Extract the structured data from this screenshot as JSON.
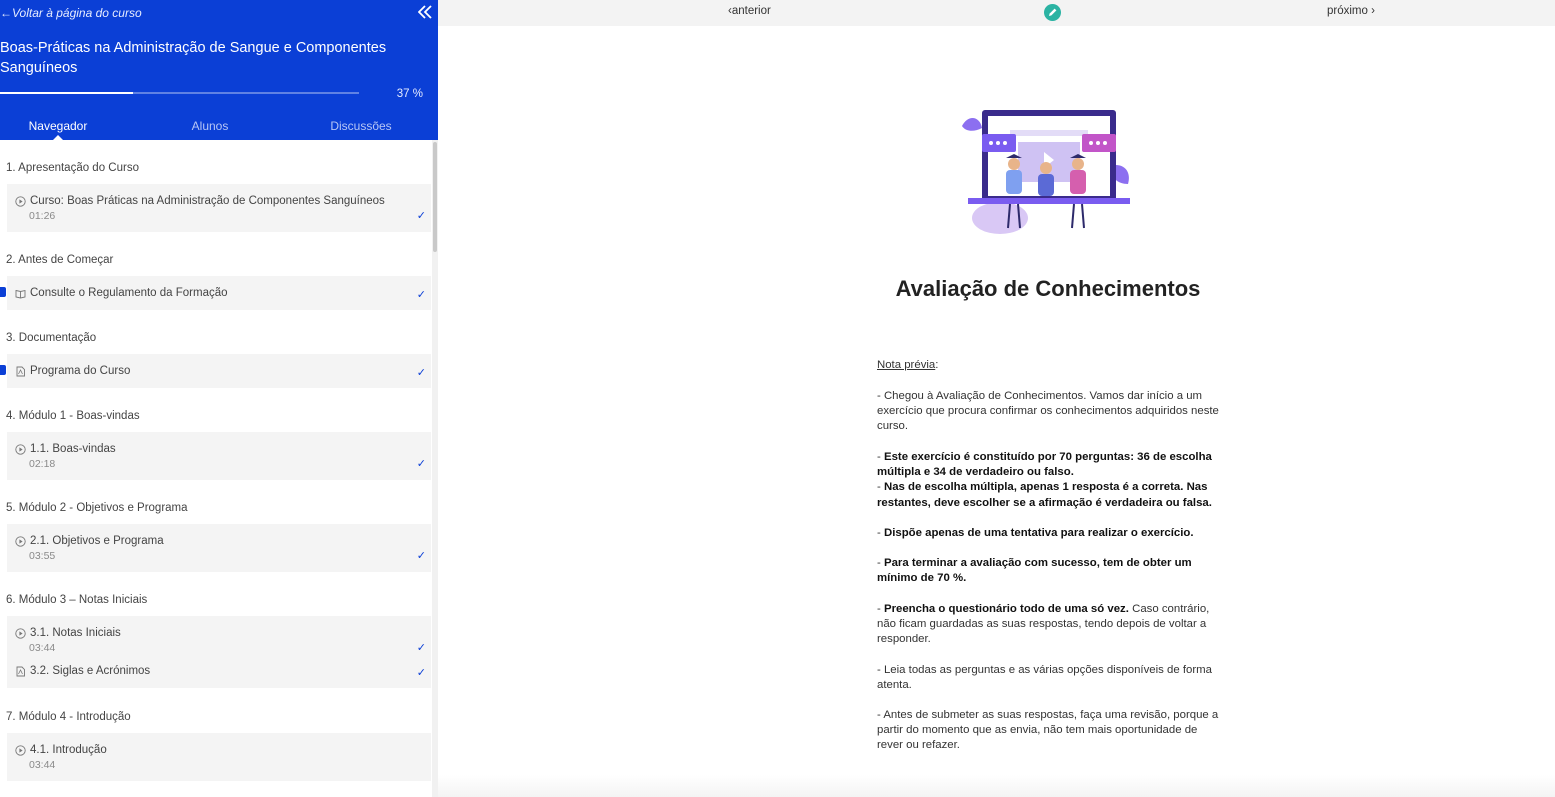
{
  "sidebar": {
    "back_link": "←Voltar à página do curso",
    "course_title": "Boas-Práticas na Administração de Sangue e Componentes Sanguíneos",
    "progress_percent": 37,
    "progress_label": "37 %",
    "tabs": [
      {
        "label": "Navegador",
        "active": true
      },
      {
        "label": "Alunos",
        "active": false
      },
      {
        "label": "Discussões",
        "active": false
      }
    ],
    "sections": [
      {
        "title": "1. Apresentação do Curso",
        "lessons": [
          {
            "icon": "play-circle-icon",
            "label": "Curso: Boas Práticas na Administração de Componentes Sanguíneos",
            "duration": "01:26",
            "completed": true
          }
        ]
      },
      {
        "title": "2. Antes de Começar",
        "lessons": [
          {
            "icon": "book-icon",
            "label": "Consulte o Regulamento da Formação",
            "duration": "",
            "completed": true
          }
        ]
      },
      {
        "title": "3. Documentação",
        "lessons": [
          {
            "icon": "pdf-icon",
            "label": "Programa do Curso",
            "duration": "",
            "completed": true
          }
        ]
      },
      {
        "title": "4. Módulo 1 - Boas-vindas",
        "lessons": [
          {
            "icon": "play-circle-icon",
            "label": "1.1. Boas-vindas",
            "duration": "02:18",
            "completed": true
          }
        ]
      },
      {
        "title": "5. Módulo 2 - Objetivos e Programa",
        "lessons": [
          {
            "icon": "play-circle-icon",
            "label": "2.1. Objetivos e Programa",
            "duration": "03:55",
            "completed": true
          }
        ]
      },
      {
        "title": "6. Módulo 3 – Notas Iniciais",
        "lessons": [
          {
            "icon": "play-circle-icon",
            "label": "3.1. Notas Iniciais",
            "duration": "03:44",
            "completed": true
          },
          {
            "icon": "pdf-icon",
            "label": "3.2. Siglas e Acrónimos",
            "duration": "",
            "completed": true
          }
        ]
      },
      {
        "title": "7. Módulo 4 - Introdução",
        "lessons": [
          {
            "icon": "play-circle-icon",
            "label": "4.1. Introdução",
            "duration": "03:44",
            "completed": false
          }
        ]
      }
    ],
    "check_glyph": "✓"
  },
  "topbar": {
    "prev_label": "anterior",
    "next_label": "próximo",
    "accent_color": "#2bb3a3"
  },
  "content": {
    "heading": "Avaliação de Conhecimentos",
    "note_label": "Nota prévia",
    "p1": "- Chegou à Avaliação de Conhecimentos. Vamos dar início a um exercício que procura confirmar os conhecimentos adquiridos neste curso.",
    "p2_bold": "Este exercício é constituído por 70 perguntas: 36 de escolha múltipla e 34 de verdadeiro ou falso.",
    "p3_bold": "Nas de escolha múltipla, apenas 1 resposta é a correta. Nas restantes, deve escolher se a afirmação é verdadeira ou falsa.",
    "p4_bold": "Dispõe apenas de uma tentativa para realizar o exercício.",
    "p5_bold": "Para terminar a avaliação com sucesso, tem de obter um mínimo de 70 %.",
    "p6_bold": "Preencha o questionário todo de uma só vez.",
    "p6_rest": " Caso contrário, não ficam guardadas as suas respostas, tendo depois de voltar a responder.",
    "p7": "- Leia todas as perguntas e as várias opções disponíveis de forma atenta.",
    "p8": "- Antes de submeter as suas respostas, faça uma revisão, porque a partir do momento que as envia, não tem mais oportunidade de rever ou refazer."
  },
  "colors": {
    "primary": "#0b3fd6",
    "illustration_purple": "#7a5cf0"
  }
}
